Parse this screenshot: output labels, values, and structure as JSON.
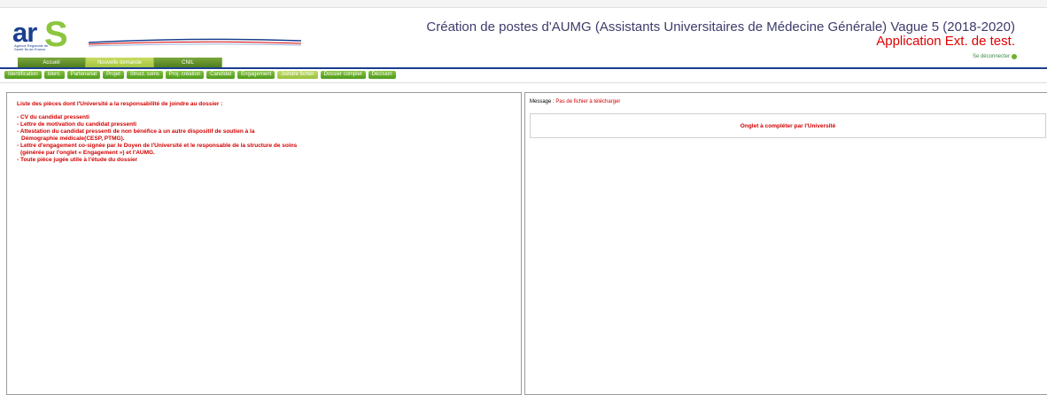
{
  "header": {
    "title": "Création de postes d'AUMG (Assistants Universitaires de Médecine Générale) Vague 5 (2018-2020)",
    "subtitle": "Application Ext. de test.",
    "logout_label": "Se déconnecter",
    "logo": {
      "text_ar": "ar",
      "text_s": "S",
      "subtext": "Agence Régionale de Santé Île-de-France",
      "primary_color": "#1b3f8f",
      "accent_color": "#8cc63f"
    }
  },
  "main_nav": [
    {
      "label": "Accueil",
      "active": false
    },
    {
      "label": "Nouvelle demande",
      "active": true
    },
    {
      "label": "CNIL",
      "active": false
    }
  ],
  "sub_nav": [
    {
      "label": "Identification",
      "active": false
    },
    {
      "label": "Ident.",
      "active": false
    },
    {
      "label": "Partenariat",
      "active": false
    },
    {
      "label": "Projet",
      "active": false
    },
    {
      "label": "Struct. soins",
      "active": false
    },
    {
      "label": "Proj. création",
      "active": false
    },
    {
      "label": "Candidat",
      "active": false
    },
    {
      "label": "Engagement",
      "active": false
    },
    {
      "label": "Joindre fichier",
      "active": true
    },
    {
      "label": "Dossier complet",
      "active": false
    },
    {
      "label": "Décision",
      "active": false
    }
  ],
  "left_panel": {
    "heading": "Liste des pièces dont l'Université a la responsabilité de joindre au dossier :",
    "items": [
      "- CV du candidat pressenti",
      "- Lettre de motivation du candidat pressenti",
      "- Attestation du candidat pressenti de non bénéfice à un autre dispositif de soutien à la",
      "   Démographie médicale(CESP, PTMG).",
      "- Lettre d'engagement co-signée par le Doyen de l'Université et le responsable de la structure de soins",
      "  (générée par l'onglet « Engagement ») et l'AUMG.",
      "- Toute pièce jugée utile à l'étude du dossier"
    ]
  },
  "right_panel": {
    "message_label": "Message :",
    "message_value": "Pas de fichier à télécharger",
    "notice": "Onglet à compléter par l'Université"
  }
}
